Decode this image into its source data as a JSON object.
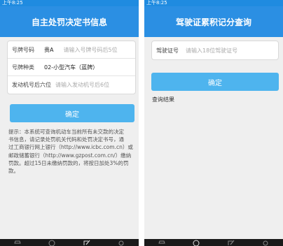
{
  "left": {
    "status_time": "上午8:25",
    "title": "自主处罚决定书信息",
    "fields": [
      {
        "label": "号牌号码",
        "value": "贵A",
        "placeholder": "请输入号牌号码后5位"
      },
      {
        "label": "号牌种类",
        "value": "02-小型汽车（蓝牌）",
        "placeholder": ""
      },
      {
        "label": "发动机号后六位",
        "value": "",
        "placeholder": "请输入发动机号后6位"
      }
    ],
    "submit_label": "确定",
    "notice_lines": [
      "提示：本系统可查询机动车当前所有未交款的决定",
      "书信息，请记录处罚机关代码和处罚决定书号，通",
      "过工商银行网上银行（http://www.icbc.com.cn）或",
      "邮政储蓄银行（http://www.gzpost.com.cn/）缴纳",
      "罚款。超过15日未缴纳罚款的，将按日加处3%的罚",
      "款。"
    ]
  },
  "right": {
    "status_time": "上午8:25",
    "title": "驾驶证累积记分查询",
    "field": {
      "label": "驾驶证号",
      "placeholder": "请输入18位驾驶证号"
    },
    "submit_label": "确定",
    "result_label": "查询结果"
  },
  "tabbar": {
    "icons": [
      "car-icon",
      "info-icon",
      "edit-icon",
      "gear-icon"
    ]
  }
}
